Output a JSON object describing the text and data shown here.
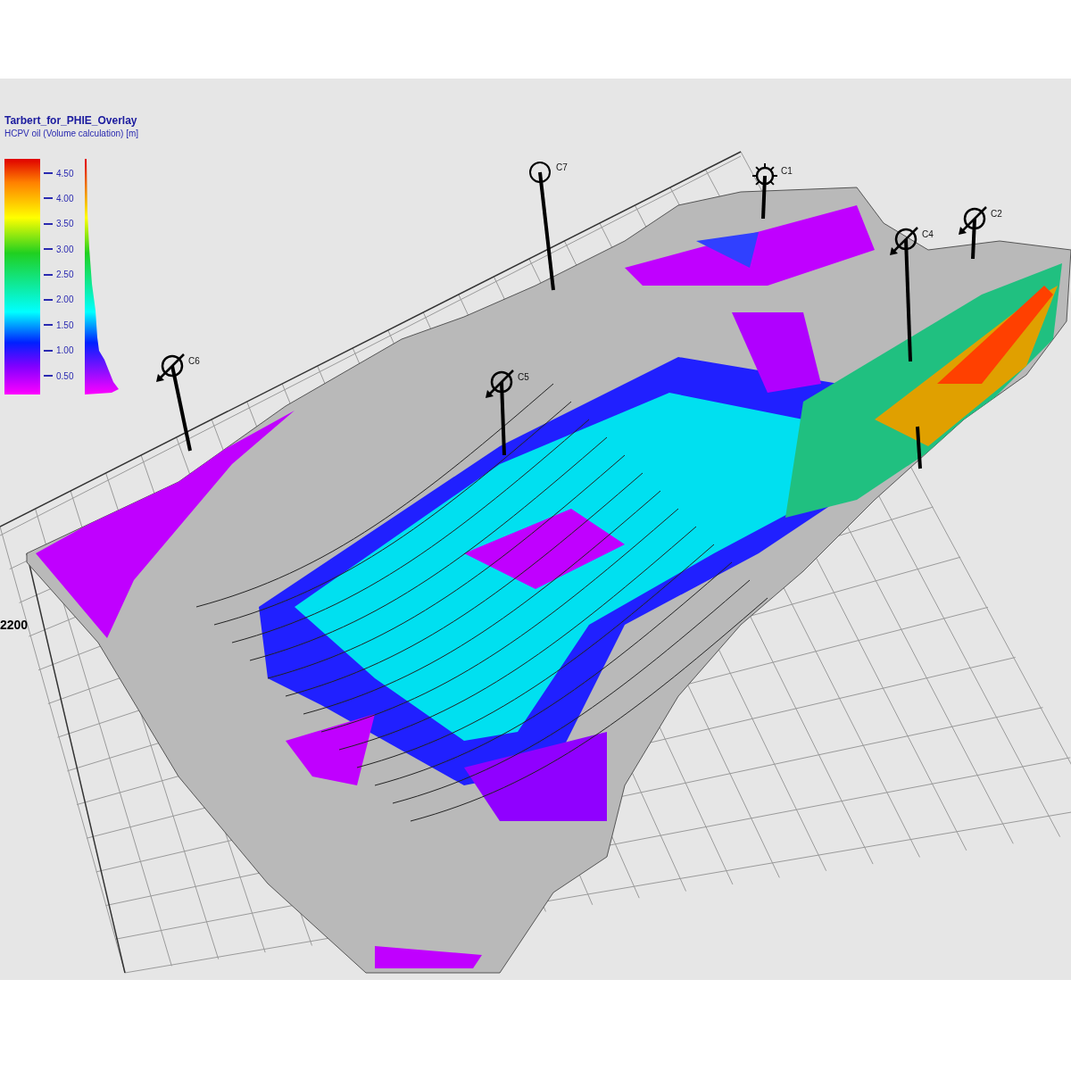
{
  "legend": {
    "title": "Tarbert_for_PHIE_Overlay",
    "subtitle": "HCPV oil (Volume calculation) [m]",
    "ticks": [
      "4.50",
      "4.00",
      "3.50",
      "3.00",
      "2.50",
      "2.00",
      "1.50",
      "1.00",
      "0.50"
    ]
  },
  "wells": [
    {
      "label": "C7",
      "kind": "circle"
    },
    {
      "label": "C1",
      "kind": "sun"
    },
    {
      "label": "C4",
      "kind": "crossed"
    },
    {
      "label": "C2",
      "kind": "crossed"
    },
    {
      "label": "C6",
      "kind": "crossed"
    },
    {
      "label": "C5",
      "kind": "crossed"
    }
  ],
  "axis_label": "2200"
}
